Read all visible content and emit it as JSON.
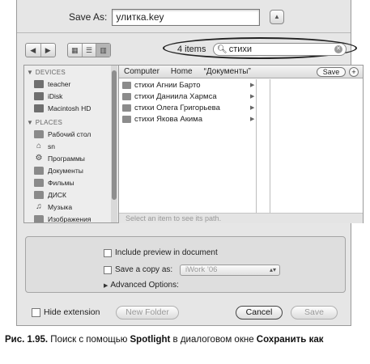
{
  "save_as": {
    "label": "Save As:",
    "value": "улитка.key"
  },
  "toolbar": {
    "items_count": "4 items",
    "search_value": "стихи"
  },
  "sidebar": {
    "devices_header": "▼ DEVICES",
    "devices": [
      "teacher",
      "iDisk",
      "Macintosh HD"
    ],
    "places_header": "▼ PLACES",
    "places": [
      "Рабочий стол",
      "sn",
      "Программы",
      "Документы",
      "Фильмы",
      "ДИСК",
      "Музыка",
      "Изображения"
    ]
  },
  "path_bar": {
    "items": [
      "Computer",
      "Home",
      "“Документы”"
    ],
    "save_label": "Save",
    "plus": "+"
  },
  "files": [
    "стихи Агнии Барто",
    "стихи Даниила Хармса",
    "стихи Олега Григорьева",
    "стихи Якова Акима"
  ],
  "status_text": "Select an item to see its path.",
  "options": {
    "include_preview": "Include preview in document",
    "save_copy": "Save a copy as:",
    "copy_format": "iWork ’06",
    "advanced": "Advanced Options:"
  },
  "bottom": {
    "hide_extension": "Hide extension",
    "new_folder": "New Folder",
    "cancel": "Cancel",
    "save": "Save"
  },
  "caption": {
    "prefix": "Рис. 1.95.",
    "text1": " Поиск с помощью ",
    "bold1": "Spotlight",
    "text2": " в диалоговом окне ",
    "bold2": "Сохранить как"
  }
}
